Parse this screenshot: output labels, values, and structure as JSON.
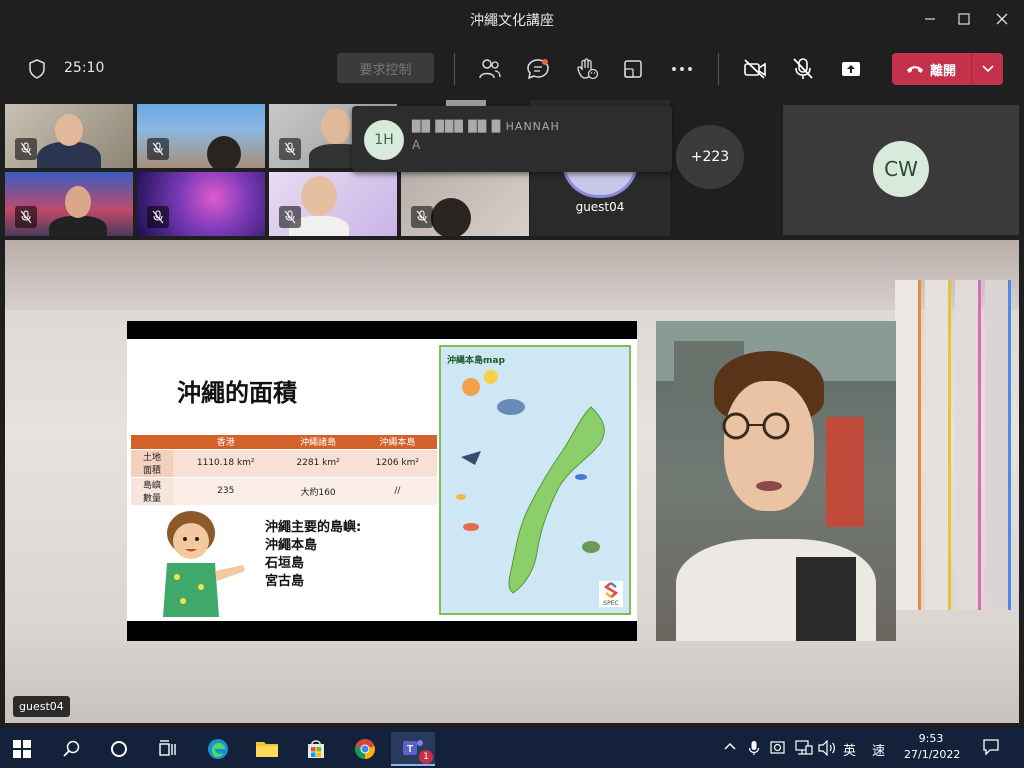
{
  "window": {
    "title": "沖繩文化講座"
  },
  "toolbar": {
    "timer": "25:10",
    "request_control_label": "要求控制",
    "leave_label": "離開"
  },
  "gallery": {
    "overlay": {
      "avatar_initials": "1H",
      "name_text": "██ ███ ██ █ HANNAH",
      "sub_text": "A"
    },
    "guest_name": "guest04",
    "overflow_count": "+223",
    "cw_initials": "CW"
  },
  "slide": {
    "title": "沖繩的面積",
    "table": {
      "headers": [
        "",
        "香港",
        "沖繩諸島",
        "沖繩本島"
      ],
      "rows": [
        {
          "label": "土地\n面積",
          "cells": [
            "1110.18 km²",
            "2281 km²",
            "1206 km²"
          ]
        },
        {
          "label": "島嶼\n數量",
          "cells": [
            "235",
            "大約160",
            "//"
          ]
        }
      ]
    },
    "islands_heading": "沖繩主要的島嶼:",
    "islands": [
      "沖繩本島",
      "石垣島",
      "宮古島"
    ],
    "map_title": "沖縄本島map",
    "logo_text": "SPEC"
  },
  "stage": {
    "speaker_name": "guest04"
  },
  "taskbar": {
    "ime_lang": "英",
    "ime_mode": "速",
    "time": "9:53",
    "date": "27/1/2022",
    "teams_badge": "1"
  },
  "colors": {
    "leave_red": "#c4314b",
    "taskbar_bg": "#14213a",
    "slide_accent": "#d4602a"
  }
}
